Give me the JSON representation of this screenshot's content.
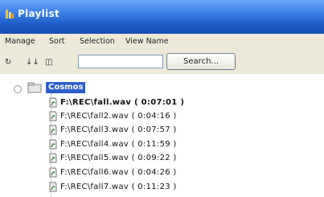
{
  "window": {
    "title": "Playlist"
  },
  "menu": [
    "Manage",
    "Sort",
    "Selection",
    "View Name"
  ],
  "toolbar": {
    "buttons": [
      {
        "label": "↻",
        "icon": "refresh-icon"
      },
      {
        "label": "↓↓",
        "icon": "sort-down-icon"
      },
      {
        "label": "◫",
        "icon": "panel-icon"
      }
    ],
    "search_value": "",
    "search_button": "Search..."
  },
  "tree": {
    "root": "Cosmos",
    "items": [
      {
        "label": "F:\\REC\\fall.wav ( 0:07:01 )",
        "bold": true
      },
      {
        "label": "F:\\REC\\fall2.wav ( 0:04:16 )",
        "bold": false
      },
      {
        "label": "F:\\REC\\fall3.wav ( 0:07:57 )",
        "bold": false
      },
      {
        "label": "F:\\REC\\fall4.wav ( 0:11:59 )",
        "bold": false
      },
      {
        "label": "F:\\REC\\fall5.wav ( 0:09:22 )",
        "bold": false
      },
      {
        "label": "F:\\REC\\fall6.wav ( 0:04:26 )",
        "bold": false
      },
      {
        "label": "F:\\REC\\fall7.wav ( 0:11:23 )",
        "bold": false
      }
    ]
  },
  "colors": {
    "titlebar": "#1f5fc8",
    "menubar": "#ece9d8",
    "selection": "#2f5fc9"
  }
}
